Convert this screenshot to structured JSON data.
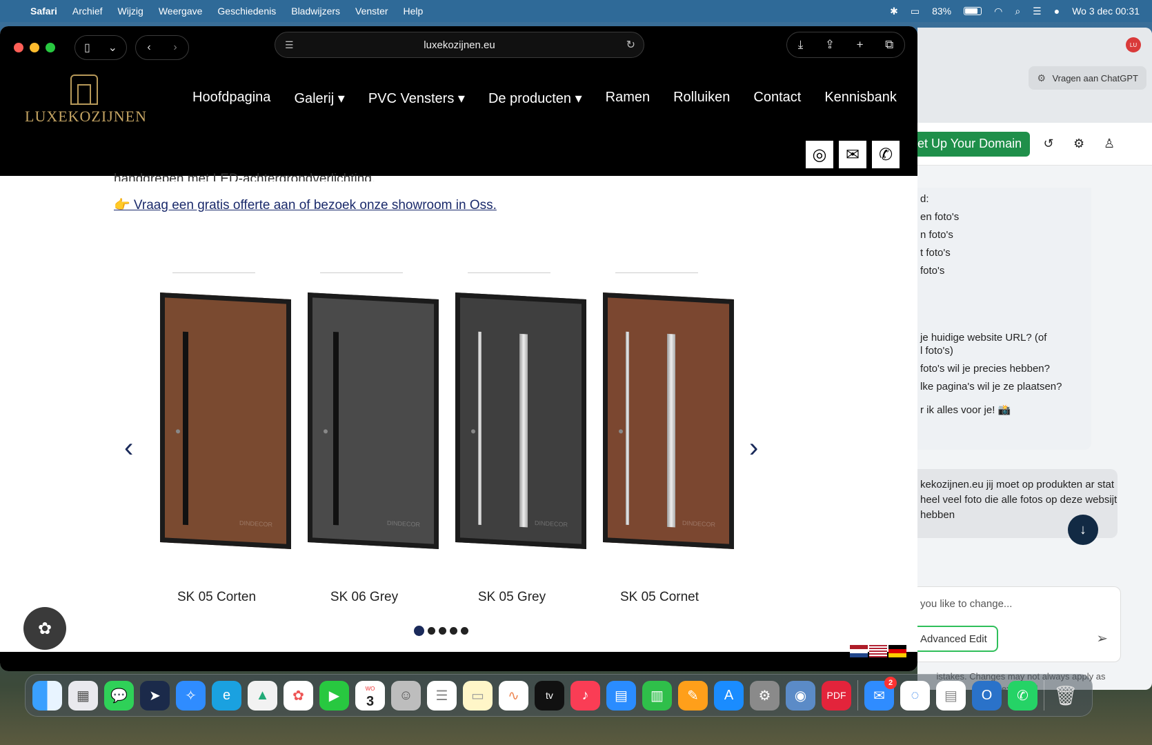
{
  "menubar": {
    "app": "Safari",
    "items": [
      "Archief",
      "Wijzig",
      "Weergave",
      "Geschiedenis",
      "Bladwijzers",
      "Venster",
      "Help"
    ],
    "battery": "83%",
    "datetime": "Wo 3 dec  00:31"
  },
  "browser": {
    "url": "luxekozijnen.eu"
  },
  "site": {
    "logo_text": "LUXEKOZIJNEN",
    "nav": [
      "Hoofdpagina",
      "Galerij ▾",
      "PVC Vensters ▾",
      "De producten ▾",
      "Ramen",
      "Rolluiken",
      "Contact",
      "Kennisbank"
    ],
    "cut_text": "handgrepen met LED-achtergrondverlichting.",
    "cta": "👉 Vraag een gratis offerte aan of bezoek onze showroom in Oss.",
    "doors": [
      {
        "label": "SK 05 Corten",
        "color": "#7a4a30",
        "style": "handle"
      },
      {
        "label": "SK 06 Grey",
        "color": "#4a4a4a",
        "style": "handle"
      },
      {
        "label": "SK 05 Grey",
        "color": "#3f3f3f",
        "style": "glass"
      },
      {
        "label": "SK 05 Cornet",
        "color": "#7b4730",
        "style": "glass"
      }
    ],
    "door_brand": "DINDECOR",
    "prev": "‹",
    "next": "›",
    "dots": 5,
    "active_dot": 0
  },
  "side_panel": {
    "avatar": "LU",
    "chatgpt_button": "Vragen aan ChatGPT",
    "domain_button": "et Up Your Domain",
    "chat_lines": [
      "d:",
      "en foto's",
      "n foto's",
      "t foto's",
      "foto's",
      "je huidige website URL? (of",
      "l foto's)",
      "foto's wil je precies hebben?",
      "lke pagina's wil je ze plaatsen?",
      "r ik alles voor je! 📸"
    ],
    "user_message": "kekozijnen.eu jij moet op produkten ar stat heel veel foto die alle fotos op deze websijt hebben",
    "input_placeholder": "you like to change...",
    "advanced_edit": "Advanced Edit",
    "disclaimer": "istakes. Changes may not always apply as expected."
  },
  "dock": {
    "mail_badge": "2",
    "calendar_day": "3",
    "calendar_month": "WO"
  },
  "colors": {
    "accent_navy": "#1a2a5a",
    "domain_green": "#1f8f4a",
    "gold": "#c4a463"
  }
}
